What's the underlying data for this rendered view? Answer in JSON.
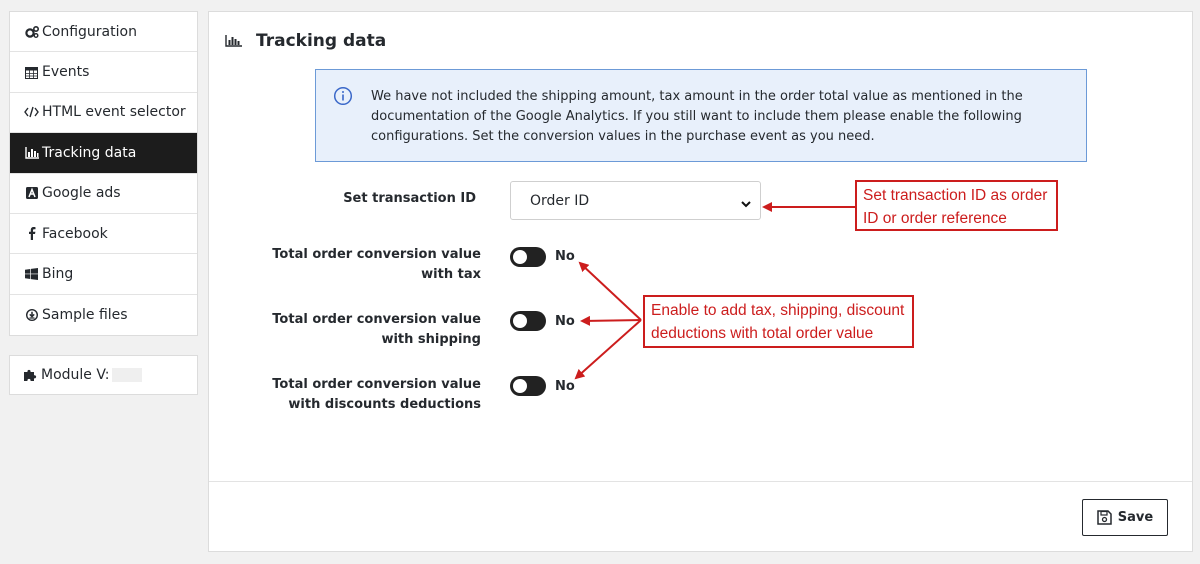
{
  "sidebar": {
    "items": [
      {
        "label": "Configuration",
        "icon": "gears-icon"
      },
      {
        "label": "Events",
        "icon": "calendar-icon"
      },
      {
        "label": "HTML event selector",
        "icon": "code-icon"
      },
      {
        "label": "Tracking data",
        "icon": "bar-chart-icon",
        "active": true
      },
      {
        "label": "Google ads",
        "icon": "google-ads-icon"
      },
      {
        "label": "Facebook",
        "icon": "facebook-icon"
      },
      {
        "label": "Bing",
        "icon": "windows-icon"
      },
      {
        "label": "Sample files",
        "icon": "download-circle-icon"
      }
    ],
    "module": {
      "label": "Module V:",
      "icon": "puzzle-icon"
    }
  },
  "panel": {
    "title": "Tracking data",
    "info": "We have not included the shipping amount, tax amount in the order total value as mentioned in the documentation of the Google Analytics. If you still want to include them please enable the following configurations. Set the conversion values in the purchase event as you need.",
    "fields": {
      "transaction_label": "Set transaction ID",
      "transaction_value": "Order ID",
      "tax_label": "Total order conversion value with tax",
      "tax_state": "No",
      "shipping_label": "Total order conversion value with shipping",
      "shipping_state": "No",
      "discount_label": "Total order conversion value with discounts deductions",
      "discount_state": "No"
    },
    "save_label": "Save"
  },
  "annotations": {
    "transaction_note": "Set transaction ID as order ID or order reference",
    "toggles_note": "Enable to add tax, shipping, discount deductions with total order value"
  },
  "colors": {
    "accent_dark": "#1c1c1c",
    "info_bg": "#e8f0fb",
    "info_border": "#6c9ad7",
    "annotation_red": "#cc1d1d"
  }
}
